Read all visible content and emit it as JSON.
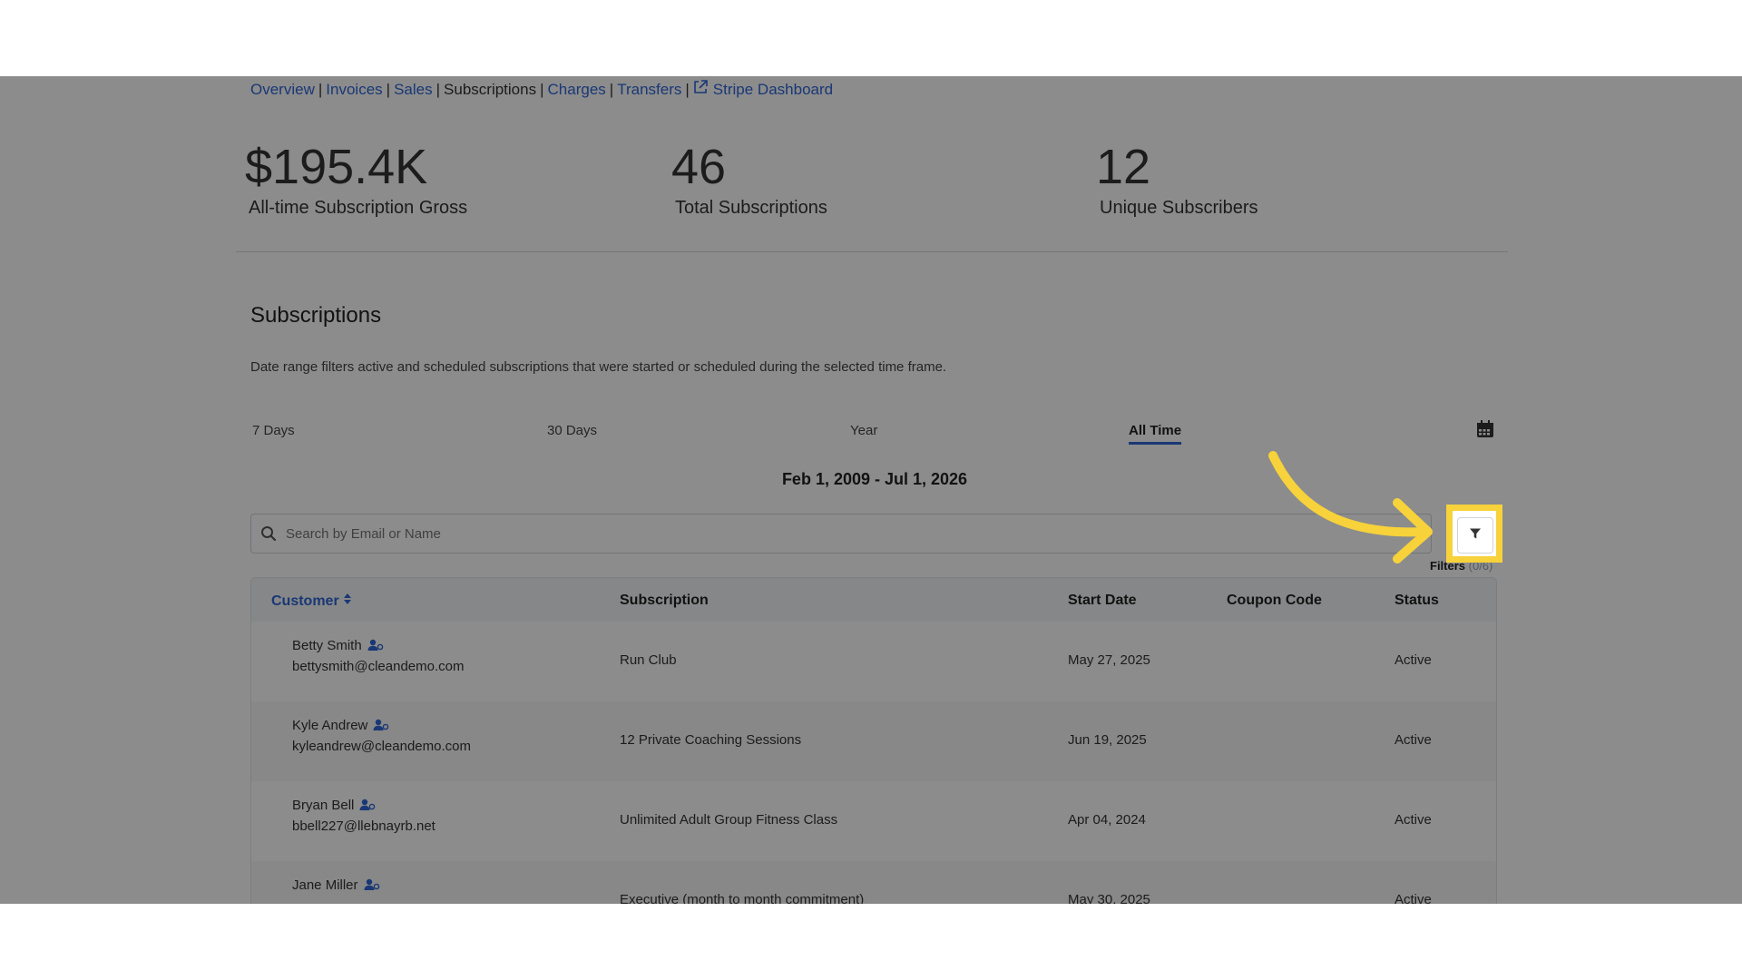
{
  "nav": {
    "overview": "Overview",
    "invoices": "Invoices",
    "sales": "Sales",
    "subscriptions": "Subscriptions",
    "charges": "Charges",
    "transfers": "Transfers",
    "stripe_dashboard": "Stripe Dashboard",
    "separator": "|"
  },
  "stats": [
    {
      "value": "$195.4K",
      "label": "All-time Subscription Gross"
    },
    {
      "value": "46",
      "label": "Total Subscriptions"
    },
    {
      "value": "12",
      "label": "Unique Subscribers"
    }
  ],
  "section": {
    "title": "Subscriptions",
    "description": "Date range filters active and scheduled subscriptions that were started or scheduled during the selected time frame."
  },
  "range_tabs": [
    "7 Days",
    "30 Days",
    "Year",
    "All Time"
  ],
  "active_range": "All Time",
  "date_range": "Feb 1, 2009 - Jul 1, 2026",
  "search": {
    "placeholder": "Search by Email or Name"
  },
  "filters": {
    "label": "Filters",
    "suffix": "(0/6)"
  },
  "table": {
    "headers": {
      "customer": "Customer",
      "subscription": "Subscription",
      "start_date": "Start Date",
      "coupon_code": "Coupon Code",
      "status": "Status"
    },
    "rows": [
      {
        "name": "Betty Smith",
        "email": "bettysmith@cleandemo.com",
        "subscription": "Run Club",
        "start_date": "May 27, 2025",
        "coupon": "",
        "status": "Active"
      },
      {
        "name": "Kyle Andrew",
        "email": "kyleandrew@cleandemo.com",
        "subscription": "12 Private Coaching Sessions",
        "start_date": "Jun 19, 2025",
        "coupon": "",
        "status": "Active"
      },
      {
        "name": "Bryan Bell",
        "email": "bbell227@llebnayrb.net",
        "subscription": "Unlimited Adult Group Fitness Class",
        "start_date": "Apr 04, 2024",
        "coupon": "",
        "status": "Active"
      },
      {
        "name": "Jane Miller",
        "email": "",
        "subscription": "Executive (month to month commitment)",
        "start_date": "May 30, 2025",
        "coupon": "",
        "status": "Active"
      }
    ]
  },
  "colors": {
    "accent": "#2f66d6",
    "highlight": "#f7d23a",
    "overlay": "rgba(0,0,0,0.45)"
  }
}
